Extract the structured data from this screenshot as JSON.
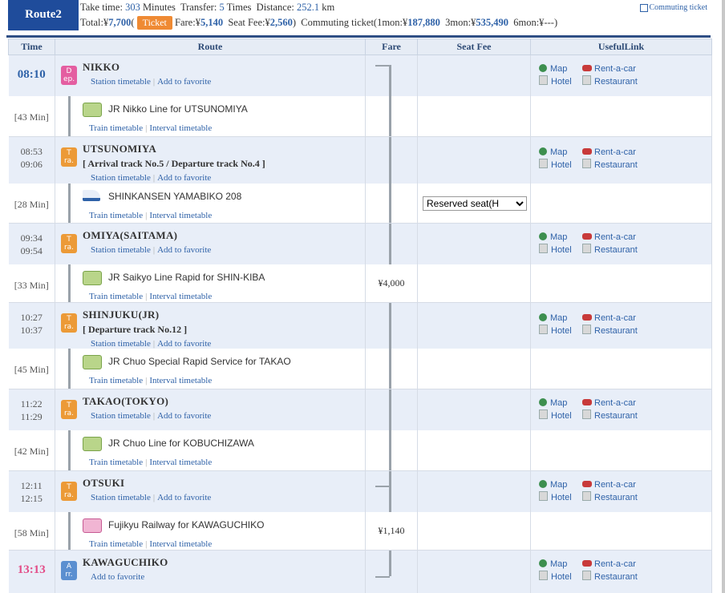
{
  "header": {
    "route_label": "Route2",
    "take_time_label": "Take time:",
    "take_time_value": "303",
    "minutes_label": "Minutes",
    "transfer_label": "Transfer:",
    "transfer_value": "5",
    "times_label": "Times",
    "distance_label": "Distance:",
    "distance_value": "252.1",
    "km_label": "km",
    "total_label": "Total:¥",
    "total_value": "7,700",
    "ticket_label": "Ticket",
    "fare_label": "Fare:¥",
    "fare_value": "5,140",
    "seat_fee_label": "Seat Fee:¥",
    "seat_fee_value": "2,560",
    "commuting_label": "Commuting ticket(1mon:¥",
    "mon1_value": "187,880",
    "mon3_label": "3mon:¥",
    "mon3_value": "535,490",
    "mon6_label": "6mon:¥",
    "mon6_value": "---",
    "commuting_link": "Commuting ticket"
  },
  "columns": [
    "Time",
    "Route",
    "Fare",
    "Seat Fee",
    "UsefulLink"
  ],
  "links": {
    "map": "Map",
    "rent": "Rent-a-car",
    "hotel": "Hotel",
    "restaurant": "Restaurant"
  },
  "stations": [
    {
      "name": "NIKKO",
      "time1": "08:10",
      "time2": "",
      "badge": "D\nep.",
      "track": "",
      "links": [
        "Station timetable",
        "Add to favorite"
      ]
    },
    {
      "name": "UTSUNOMIYA",
      "time1": "08:53",
      "time2": "09:06",
      "badge": "T\nra.",
      "track": "[ Arrival track No.5 / Departure track No.4 ]",
      "links": [
        "Station timetable",
        "Add to favorite"
      ]
    },
    {
      "name": "OMIYA(SAITAMA)",
      "time1": "09:34",
      "time2": "09:54",
      "badge": "T\nra.",
      "track": "",
      "links": [
        "Station timetable",
        "Add to favorite"
      ]
    },
    {
      "name": "SHINJUKU(JR)",
      "time1": "10:27",
      "time2": "10:37",
      "badge": "T\nra.",
      "track": "[ Departure track No.12 ]",
      "links": [
        "Station timetable",
        "Add to favorite"
      ]
    },
    {
      "name": "TAKAO(TOKYO)",
      "time1": "11:22",
      "time2": "11:29",
      "badge": "T\nra.",
      "track": "",
      "links": [
        "Station timetable",
        "Add to favorite"
      ]
    },
    {
      "name": "OTSUKI",
      "time1": "12:11",
      "time2": "12:15",
      "badge": "T\nra.",
      "track": "",
      "links": [
        "Station timetable",
        "Add to favorite"
      ]
    },
    {
      "name": "KAWAGUCHIKO",
      "time1": "13:13",
      "time2": "",
      "badge": "A\nrr.",
      "track": "",
      "links": [
        "Add to favorite"
      ]
    }
  ],
  "segments": [
    {
      "duration": "[43 Min]",
      "line": "JR Nikko Line  for UTSUNOMIYA",
      "fare": "",
      "seat": "",
      "links": [
        "Train timetable",
        "Interval timetable"
      ],
      "icon": "jr-train-icon"
    },
    {
      "duration": "[28 Min]",
      "line": "SHINKANSEN YAMABIKO 208",
      "fare": "",
      "seat": "Reserved seat(H",
      "links": [
        "Train timetable",
        "Interval timetable"
      ],
      "icon": "shinkansen-icon"
    },
    {
      "duration": "[33 Min]",
      "line": "JR Saikyo Line Rapid  for SHIN-KIBA",
      "fare": "¥4,000",
      "seat": "",
      "links": [
        "Train timetable",
        "Interval timetable"
      ],
      "icon": "jr-train-icon"
    },
    {
      "duration": "[45 Min]",
      "line": "JR Chuo Special Rapid Service  for TAKAO",
      "fare": "",
      "seat": "",
      "links": [
        "Train timetable",
        "Interval timetable"
      ],
      "icon": "jr-train-icon"
    },
    {
      "duration": "[42 Min]",
      "line": "JR Chuo Line  for KOBUCHIZAWA",
      "fare": "",
      "seat": "",
      "links": [
        "Train timetable",
        "Interval timetable"
      ],
      "icon": "jr-train-icon"
    },
    {
      "duration": "[58 Min]",
      "line": "Fujikyu Railway  for KAWAGUCHIKO",
      "fare": "¥1,140",
      "seat": "",
      "links": [
        "Train timetable",
        "Interval timetable"
      ],
      "icon": "fujikyu-train-icon"
    }
  ]
}
